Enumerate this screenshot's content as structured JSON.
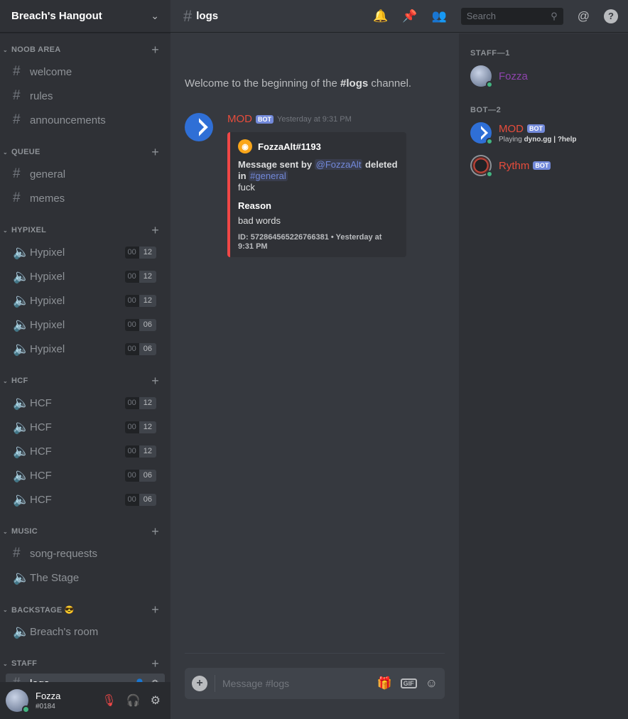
{
  "server": {
    "name": "Breach's Hangout"
  },
  "categories": [
    {
      "name": "NOOB AREA",
      "channels": [
        {
          "type": "text",
          "name": "welcome"
        },
        {
          "type": "text",
          "name": "rules"
        },
        {
          "type": "text",
          "name": "announcements"
        }
      ]
    },
    {
      "name": "QUEUE",
      "channels": [
        {
          "type": "text",
          "name": "general"
        },
        {
          "type": "text",
          "name": "memes"
        }
      ]
    },
    {
      "name": "HYPIXEL",
      "channels": [
        {
          "type": "voice",
          "name": "Hypixel",
          "users": "00",
          "limit": "12"
        },
        {
          "type": "voice",
          "name": "Hypixel",
          "users": "00",
          "limit": "12"
        },
        {
          "type": "voice",
          "name": "Hypixel",
          "users": "00",
          "limit": "12"
        },
        {
          "type": "voice",
          "name": "Hypixel",
          "users": "00",
          "limit": "06"
        },
        {
          "type": "voice",
          "name": "Hypixel",
          "users": "00",
          "limit": "06"
        }
      ]
    },
    {
      "name": "HCF",
      "channels": [
        {
          "type": "voice",
          "name": "HCF",
          "users": "00",
          "limit": "12"
        },
        {
          "type": "voice",
          "name": "HCF",
          "users": "00",
          "limit": "12"
        },
        {
          "type": "voice",
          "name": "HCF",
          "users": "00",
          "limit": "12"
        },
        {
          "type": "voice",
          "name": "HCF",
          "users": "00",
          "limit": "06"
        },
        {
          "type": "voice",
          "name": "HCF",
          "users": "00",
          "limit": "06"
        }
      ]
    },
    {
      "name": "MUSIC",
      "channels": [
        {
          "type": "text",
          "name": "song-requests"
        },
        {
          "type": "voice",
          "name": "The Stage"
        }
      ]
    },
    {
      "name": "BACKSTAGE 😎",
      "channels": [
        {
          "type": "voice",
          "name": "Breach's room"
        }
      ]
    },
    {
      "name": "STAFF",
      "channels": [
        {
          "type": "text",
          "name": "logs",
          "active": true
        }
      ]
    }
  ],
  "user": {
    "name": "Fozza",
    "tag": "#0184"
  },
  "channel": {
    "name": "logs"
  },
  "search": {
    "placeholder": "Search"
  },
  "welcome": {
    "prefix": "Welcome to the beginning of the ",
    "channel": "#logs",
    "suffix": " channel."
  },
  "message": {
    "author": "MOD",
    "badge": "BOT",
    "timestamp": "Yesterday at 9:31 PM",
    "embed": {
      "author": "FozzaAlt#1193",
      "desc_prefix": "Message sent by ",
      "desc_mention": "@FozzaAlt",
      "desc_mid": " deleted in ",
      "desc_channel": "#general",
      "content": "fuck",
      "field_name": "Reason",
      "field_value": "bad words",
      "footer": "ID: 572864565226766381 • Yesterday at 9:31 PM",
      "color": "#f04747"
    }
  },
  "composer": {
    "placeholder": "Message #logs"
  },
  "members": {
    "groups": [
      {
        "title": "STAFF—1",
        "members": [
          {
            "name": "Fozza",
            "color": "#8e44ad"
          }
        ]
      },
      {
        "title": "BOT—2",
        "members": [
          {
            "name": "MOD",
            "color": "#e74c3c",
            "badge": "BOT",
            "activity_prefix": "Playing ",
            "activity": "dyno.gg | ?help"
          },
          {
            "name": "Rythm",
            "color": "#e74c3c",
            "badge": "BOT"
          }
        ]
      }
    ]
  }
}
